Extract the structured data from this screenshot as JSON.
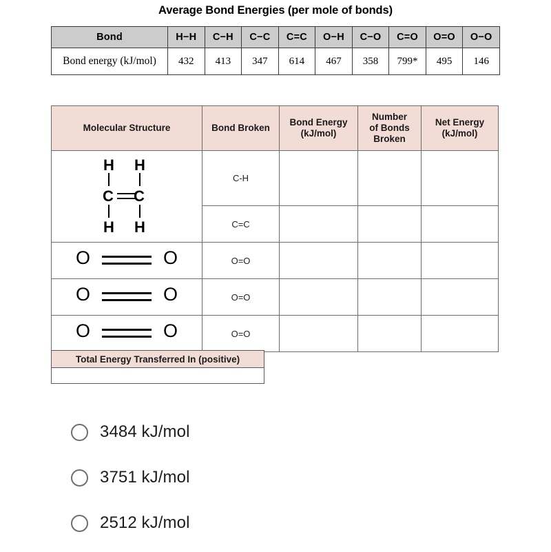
{
  "reference_table": {
    "title": "Average Bond Energies (per mole of bonds)",
    "row_labels": {
      "bond": "Bond",
      "bond_energy": "Bond energy (kJ/mol)"
    },
    "bonds": [
      "H−H",
      "C−H",
      "C−C",
      "C=C",
      "O−H",
      "C−O",
      "C=O",
      "O=O",
      "O−O"
    ],
    "energies": [
      "432",
      "413",
      "347",
      "614",
      "467",
      "358",
      "799*",
      "495",
      "146"
    ]
  },
  "worksheet_table": {
    "headers": {
      "molecular_structure": "Molecular Structure",
      "bond_broken": "Bond Broken",
      "bond_energy": "Bond Energy\n(kJ/mol)",
      "bond_energy_line1": "Bond Energy",
      "bond_energy_line2": "(kJ/mol)",
      "number_of_bonds_broken_line1": "Number",
      "number_of_bonds_broken_line2": "of Bonds",
      "number_of_bonds_broken_line3": "Broken",
      "net_energy_line1": "Net Energy",
      "net_energy_line2": "(kJ/mol)"
    },
    "rows": [
      {
        "structure": "ethene",
        "structure_atoms": {
          "h_top_left": "H",
          "h_top_right": "H",
          "c_left": "C",
          "c_right": "C",
          "h_bottom_left": "H",
          "h_bottom_right": "H"
        },
        "bond_broken": "C-H",
        "bond_energy": "",
        "number_of_bonds_broken": "",
        "net_energy": ""
      },
      {
        "structure": "",
        "bond_broken": "C=C",
        "bond_energy": "",
        "number_of_bonds_broken": "",
        "net_energy": ""
      },
      {
        "structure": "oxygen",
        "structure_atoms": {
          "o_left": "O",
          "o_right": "O"
        },
        "bond_broken": "O=O",
        "bond_energy": "",
        "number_of_bonds_broken": "",
        "net_energy": ""
      },
      {
        "structure": "oxygen",
        "structure_atoms": {
          "o_left": "O",
          "o_right": "O"
        },
        "bond_broken": "O=O",
        "bond_energy": "",
        "number_of_bonds_broken": "",
        "net_energy": ""
      },
      {
        "structure": "oxygen",
        "structure_atoms": {
          "o_left": "O",
          "o_right": "O"
        },
        "bond_broken": "O=O",
        "bond_energy": "",
        "number_of_bonds_broken": "",
        "net_energy": ""
      }
    ]
  },
  "total_energy": {
    "header": "Total Energy Transferred In (positive)",
    "value": ""
  },
  "answer_options": [
    {
      "label": "3484 kJ/mol",
      "selected": false
    },
    {
      "label": "3751 kJ/mol",
      "selected": false
    },
    {
      "label": "2512 kJ/mol",
      "selected": false
    }
  ],
  "colors": {
    "pink_header": "#f2ddd6",
    "gray_header": "#cccccc",
    "border_dark": "#3a3a3a",
    "border_light": "#6b6b6b",
    "radio_border": "#6f6f6f"
  }
}
